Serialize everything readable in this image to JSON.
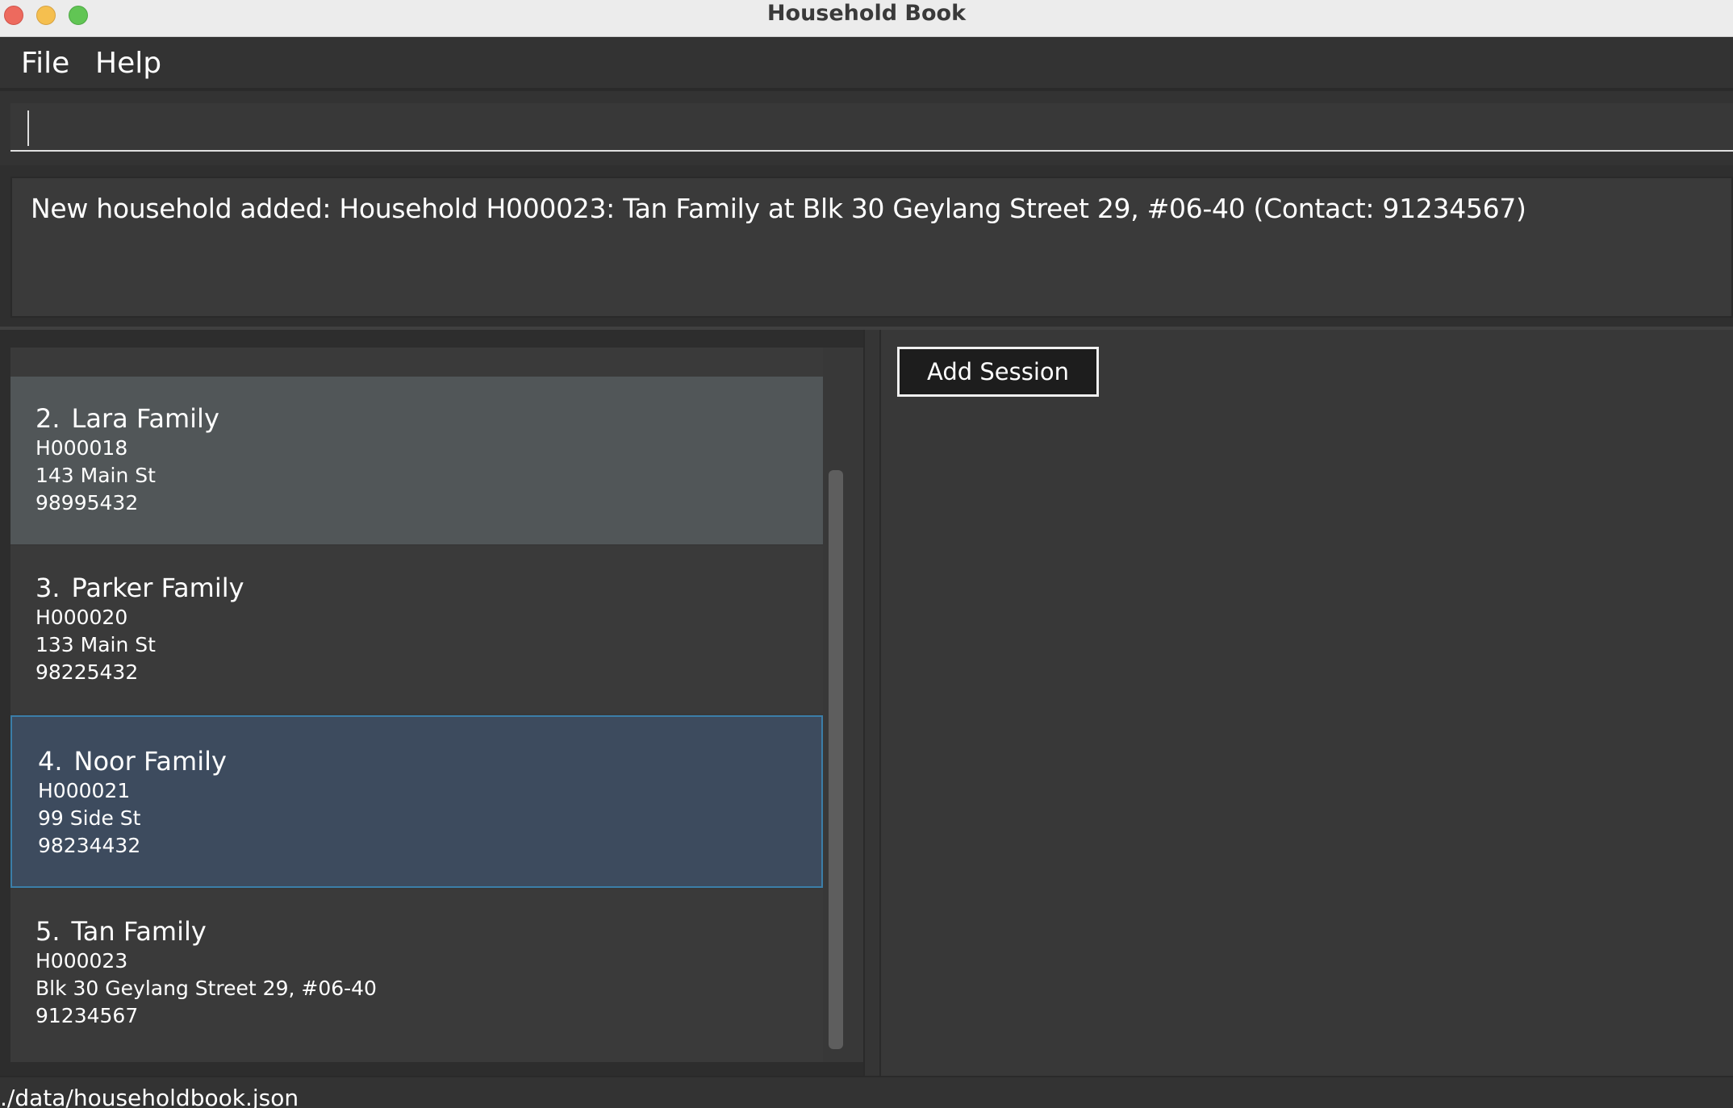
{
  "window": {
    "title": "Household Book"
  },
  "menu": {
    "items": [
      "File",
      "Help"
    ]
  },
  "command": {
    "value": "",
    "placeholder": ""
  },
  "result": {
    "message": "New household added: Household H000023: Tan Family at Blk 30 Geylang Street 29, #06-40 (Contact: 91234567)"
  },
  "households": [
    {
      "index": "2.",
      "name": "Lara Family",
      "id": "H000018",
      "address": "143 Main St",
      "contact": "98995432"
    },
    {
      "index": "3.",
      "name": "Parker Family",
      "id": "H000020",
      "address": "133 Main St",
      "contact": "98225432"
    },
    {
      "index": "4.",
      "name": "Noor Family",
      "id": "H000021",
      "address": "99 Side St",
      "contact": "98234432",
      "selected": true
    },
    {
      "index": "5.",
      "name": "Tan Family",
      "id": "H000023",
      "address": "Blk 30 Geylang Street 29, #06-40",
      "contact": "91234567"
    }
  ],
  "session_panel": {
    "add_button_label": "Add Session"
  },
  "status": {
    "path": "./data/householdbook.json"
  },
  "colors": {
    "selected_border": "#3b7ea8",
    "selected_bg": "#3d4b5e",
    "hover_bg": "#515658"
  }
}
